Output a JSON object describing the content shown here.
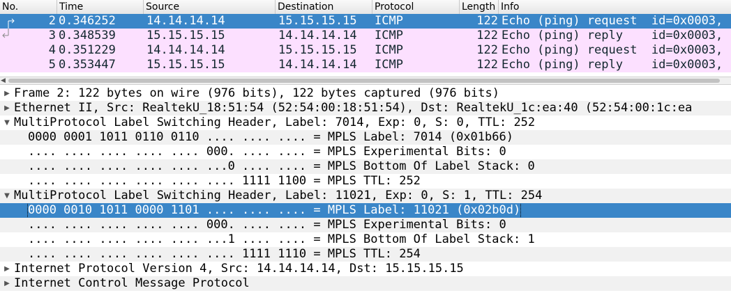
{
  "packet_list": {
    "columns": [
      "No.",
      "Time",
      "Source",
      "Destination",
      "Protocol",
      "Length",
      "Info"
    ],
    "rows": [
      {
        "no": "2",
        "time": "0.346252",
        "source": "14.14.14.14",
        "destination": "15.15.15.15",
        "protocol": "ICMP",
        "length": "122",
        "info": "Echo (ping) request  id=0x0003,"
      },
      {
        "no": "3",
        "time": "0.348539",
        "source": "15.15.15.15",
        "destination": "14.14.14.14",
        "protocol": "ICMP",
        "length": "122",
        "info": "Echo (ping) reply    id=0x0003,"
      },
      {
        "no": "4",
        "time": "0.351229",
        "source": "14.14.14.14",
        "destination": "15.15.15.15",
        "protocol": "ICMP",
        "length": "122",
        "info": "Echo (ping) request  id=0x0003,"
      },
      {
        "no": "5",
        "time": "0.353447",
        "source": "15.15.15.15",
        "destination": "14.14.14.14",
        "protocol": "ICMP",
        "length": "122",
        "info": "Echo (ping) reply    id=0x0003,"
      }
    ]
  },
  "details": {
    "lines": [
      "Frame 2: 122 bytes on wire (976 bits), 122 bytes captured (976 bits)",
      "Ethernet II, Src: RealtekU_18:51:54 (52:54:00:18:51:54), Dst: RealtekU_1c:ea:40 (52:54:00:1c:ea",
      "MultiProtocol Label Switching Header, Label: 7014, Exp: 0, S: 0, TTL: 252",
      "0000 0001 1011 0110 0110 .... .... .... = MPLS Label: 7014 (0x01b66)",
      ".... .... .... .... .... 000. .... .... = MPLS Experimental Bits: 0",
      ".... .... .... .... .... ...0 .... .... = MPLS Bottom Of Label Stack: 0",
      ".... .... .... .... .... .... 1111 1100 = MPLS TTL: 252",
      "MultiProtocol Label Switching Header, Label: 11021, Exp: 0, S: 1, TTL: 254",
      "0000 0010 1011 0000 1101 .... .... .... = MPLS Label: 11021 (0x02b0d)",
      ".... .... .... .... .... 000. .... .... = MPLS Experimental Bits: 0",
      ".... .... .... .... .... ...1 .... .... = MPLS Bottom Of Label Stack: 1",
      ".... .... .... .... .... .... 1111 1110 = MPLS TTL: 254",
      "Internet Protocol Version 4, Src: 14.14.14.14, Dst: 15.15.15.15",
      "Internet Control Message Protocol"
    ]
  }
}
